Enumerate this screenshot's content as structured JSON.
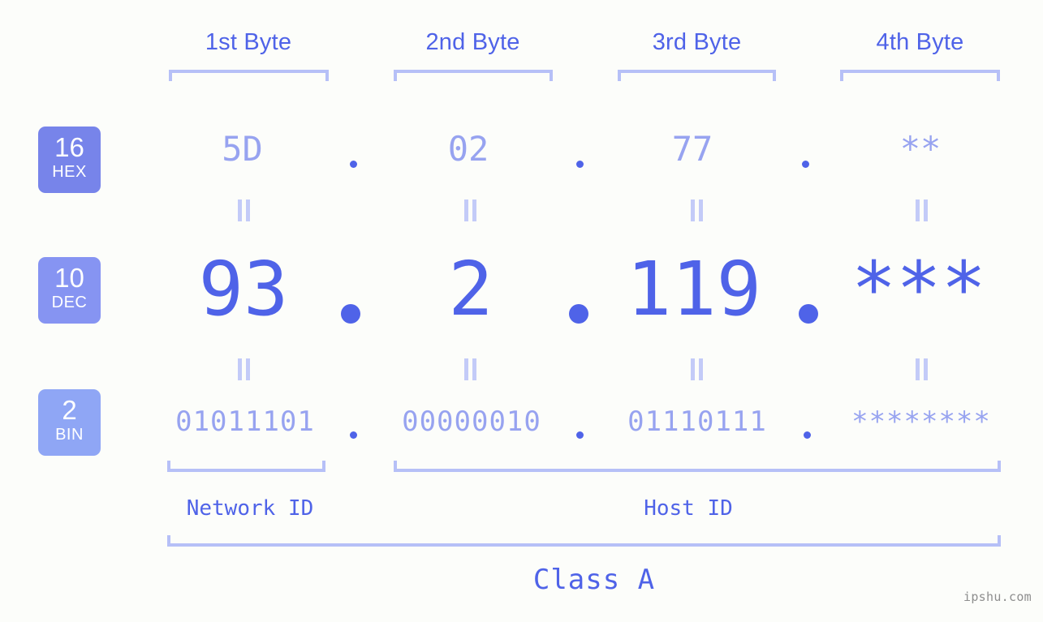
{
  "background_color": "#fcfdfa",
  "accent_color": "#4f63e8",
  "accent_light_color": "#97a3f0",
  "bracket_color": "#b6c0f7",
  "header": {
    "bytes": [
      {
        "label": "1st Byte"
      },
      {
        "label": "2nd Byte"
      },
      {
        "label": "3rd Byte"
      },
      {
        "label": "4th Byte"
      }
    ]
  },
  "bases": [
    {
      "number": "16",
      "name": "HEX",
      "color": "#7784ea"
    },
    {
      "number": "10",
      "name": "DEC",
      "color": "#8694f2"
    },
    {
      "number": "2",
      "name": "BIN",
      "color": "#8fa6f5"
    }
  ],
  "rows": {
    "hex": {
      "base_number": "16",
      "base_name": "HEX",
      "values": [
        "5D",
        "02",
        "77",
        "**"
      ],
      "separator": "."
    },
    "dec": {
      "base_number": "10",
      "base_name": "DEC",
      "values": [
        "93",
        "2",
        "119",
        "***"
      ],
      "separator": "."
    },
    "bin": {
      "base_number": "2",
      "base_name": "BIN",
      "values": [
        "01011101",
        "00000010",
        "01110111",
        "********"
      ],
      "separator": "."
    }
  },
  "equals_marks": {
    "glyph": "||",
    "count_per_row": 4
  },
  "segments": {
    "network_id": {
      "label": "Network ID"
    },
    "host_id": {
      "label": "Host ID"
    },
    "class": {
      "label": "Class A"
    }
  },
  "watermark": {
    "text": "ipshu.com"
  }
}
